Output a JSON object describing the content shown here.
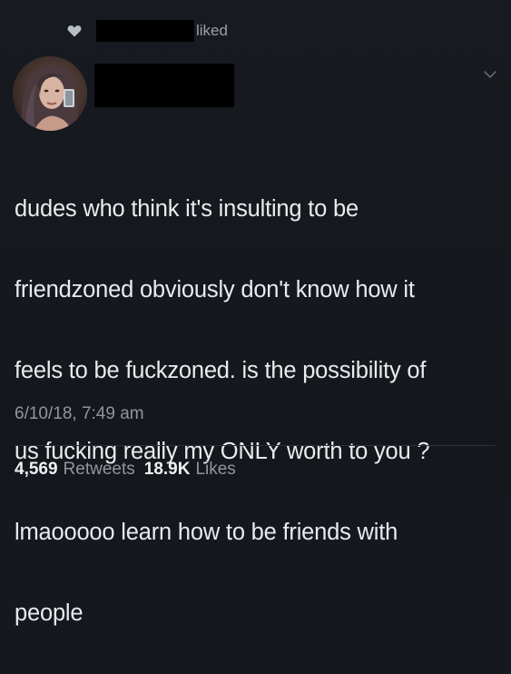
{
  "activity": {
    "liked_label": "liked"
  },
  "tweet": {
    "text_lines": [
      "dudes who think it's insulting to be",
      "friendzoned obviously don't know how it",
      "feels to be fuckzoned. is the possibility of",
      "us fucking really my ONLY worth to you ?",
      "lmaooooo learn how to be friends with",
      "people"
    ],
    "timestamp": "6/10/18, 7:49 am"
  },
  "stats": {
    "retweets_count": "4,569",
    "retweets_label": "Retweets",
    "likes_count": "18.9K",
    "likes_label": "Likes"
  },
  "icons": {
    "heart": "heart-icon",
    "chevron": "chevron-down-icon",
    "avatar": "profile-photo"
  },
  "colors": {
    "background": "#15181e",
    "text": "#e9ebee",
    "muted": "#8f969e"
  }
}
